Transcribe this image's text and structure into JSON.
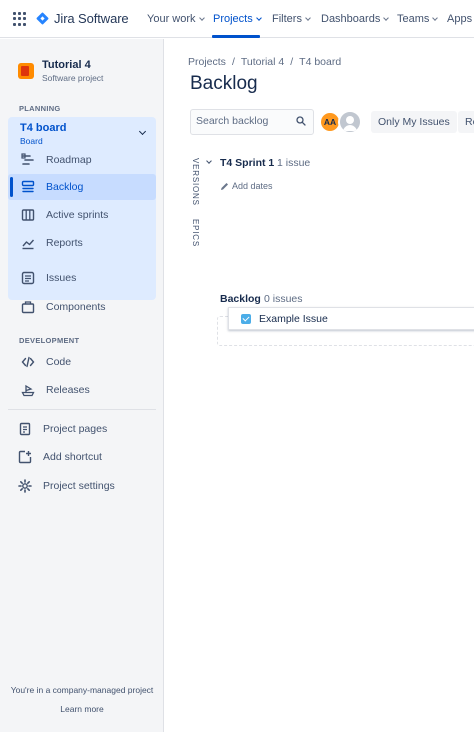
{
  "topnav": {
    "app_name": "Jira Software",
    "items": [
      {
        "label": "Your work",
        "active": false
      },
      {
        "label": "Projects",
        "active": true
      },
      {
        "label": "Filters",
        "active": false
      },
      {
        "label": "Dashboards",
        "active": false
      },
      {
        "label": "Teams",
        "active": false
      },
      {
        "label": "Apps",
        "active": false
      }
    ]
  },
  "sidebar": {
    "project": {
      "name": "Tutorial 4",
      "type": "Software project"
    },
    "planning_label": "PLANNING",
    "board": {
      "title": "T4 board",
      "subtitle": "Board"
    },
    "planning_items": [
      {
        "label": "Roadmap",
        "icon": "roadmap-icon"
      },
      {
        "label": "Backlog",
        "icon": "backlog-icon",
        "selected": true
      },
      {
        "label": "Active sprints",
        "icon": "active-sprints-icon"
      },
      {
        "label": "Reports",
        "icon": "reports-icon"
      }
    ],
    "other_items": [
      {
        "label": "Issues",
        "icon": "issues-icon"
      },
      {
        "label": "Components",
        "icon": "components-icon"
      }
    ],
    "development_label": "DEVELOPMENT",
    "development_items": [
      {
        "label": "Code",
        "icon": "code-icon"
      },
      {
        "label": "Releases",
        "icon": "releases-icon"
      }
    ],
    "bottom_items": [
      {
        "label": "Project pages",
        "icon": "pages-icon"
      },
      {
        "label": "Add shortcut",
        "icon": "add-shortcut-icon"
      },
      {
        "label": "Project settings",
        "icon": "settings-icon"
      }
    ],
    "footer_text": "You're in a company-managed project",
    "learn_more": "Learn more"
  },
  "main": {
    "breadcrumb": [
      "Projects",
      "Tutorial 4",
      "T4 board"
    ],
    "title": "Backlog",
    "search_placeholder": "Search backlog",
    "avatar_initials": "AA",
    "only_my_issues": "Only My Issues",
    "recently_updated": "Re",
    "versions_label": "VERSIONS",
    "epics_label": "EPICS",
    "sprint": {
      "name": "T4 Sprint 1",
      "count": "1 issue",
      "add_dates": "Add dates"
    },
    "backlog": {
      "name": "Backlog",
      "count": "0 issues"
    },
    "issues": [
      {
        "summary": "Example Issue",
        "type": "task",
        "color": "#4bade8"
      }
    ]
  },
  "colors": {
    "accent": "#0052cc",
    "selected_bg": "#deebff",
    "avatar_orange": "#ff991f"
  }
}
